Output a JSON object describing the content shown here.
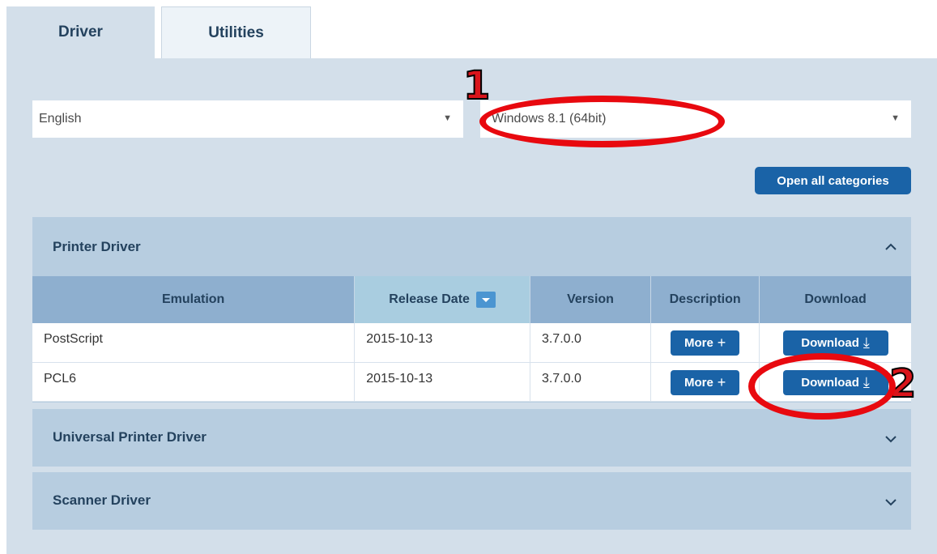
{
  "tabs": [
    {
      "label": "Driver"
    },
    {
      "label": "Utilities"
    }
  ],
  "filters": {
    "language": "English",
    "os": "Windows 8.1 (64bit)"
  },
  "open_all_label": "Open all categories",
  "sections": {
    "printer": {
      "title": "Printer Driver",
      "columns": [
        "Emulation",
        "Release Date",
        "Version",
        "Description",
        "Download"
      ],
      "rows": [
        {
          "emulation": "PostScript",
          "release_date": "2015-10-13",
          "version": "3.7.0.0",
          "more_label": "More",
          "download_label": "Download"
        },
        {
          "emulation": "PCL6",
          "release_date": "2015-10-13",
          "version": "3.7.0.0",
          "more_label": "More",
          "download_label": "Download"
        }
      ]
    },
    "universal": {
      "title": "Universal Printer Driver"
    },
    "scanner": {
      "title": "Scanner Driver"
    }
  },
  "annotations": {
    "step1": "1",
    "step2": "2"
  },
  "colors": {
    "accent": "#1a63a7",
    "panel": "#d3dfea",
    "section": "#b7cde0",
    "annotation": "#e8090f"
  }
}
